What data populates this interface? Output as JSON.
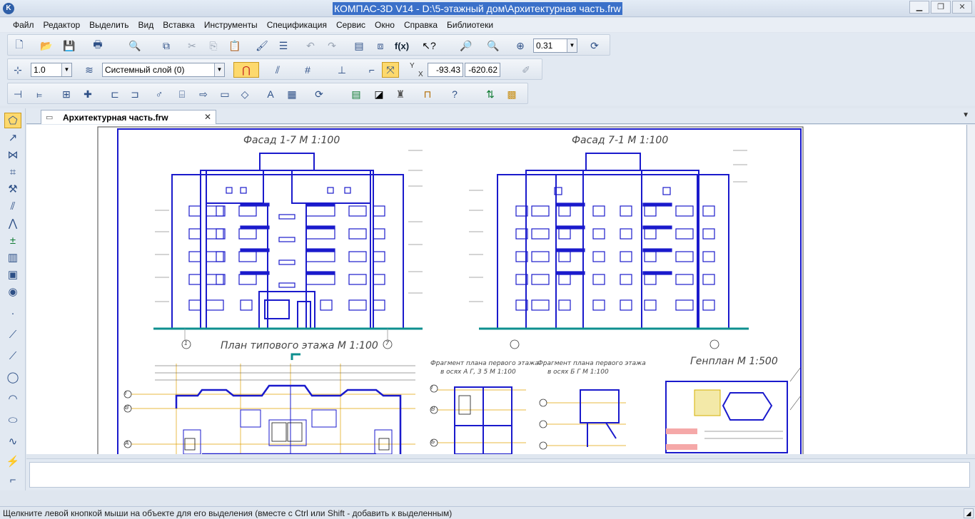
{
  "window": {
    "title": "КОМПАС-3D V14 - D:\\5-этажный дом\\Архитектурная часть.frw",
    "app_icon_letter": "K",
    "controls": {
      "minimize": "▁",
      "maximize": "❐",
      "close": "✕"
    }
  },
  "menu": [
    "Файл",
    "Редактор",
    "Выделить",
    "Вид",
    "Вставка",
    "Инструменты",
    "Спецификация",
    "Сервис",
    "Окно",
    "Справка",
    "Библиотеки"
  ],
  "toolbar": {
    "zoom_value": "0.31",
    "line_style_value": "1.0",
    "layer_value": "Системный слой (0)",
    "coord_x": "-93.43",
    "coord_y": "-620.62",
    "coord_axis_y": "Y",
    "coord_axis_x": "X",
    "fx_label": "f(x)"
  },
  "document_tab": {
    "label": "Архитектурная часть.frw",
    "close": "✕"
  },
  "drawing": {
    "facade_left_title": "Фасад 1-7   М 1:100",
    "facade_right_title": "Фасад 7-1   М 1:100",
    "plan_title": "План типового этажа   М 1:100",
    "fragment1_title": "Фрагмент плана первого этажа",
    "fragment1_sub": "в осях А Г, 3 5   М 1:100",
    "fragment2_title": "Фрагмент плана первого этажа",
    "fragment2_sub": "в осях Б Г   М 1:100",
    "genplan_title": "Генплан   М 1:500",
    "axis_1": "1",
    "axis_7": "7",
    "axis_A": "А",
    "axis_B": "Б",
    "axis_V": "В",
    "axis_G": "Г"
  },
  "colors": {
    "accent": "#3a70c9",
    "drawing_line": "#1a1acc",
    "ground_line": "#0d8f8f",
    "dimension_line": "#e0a000",
    "active_tool": "#fdd96d"
  },
  "status": {
    "text": "Щелкните левой кнопкой мыши на объекте для его выделения (вместе с Ctrl или Shift - добавить к выделенным)"
  }
}
